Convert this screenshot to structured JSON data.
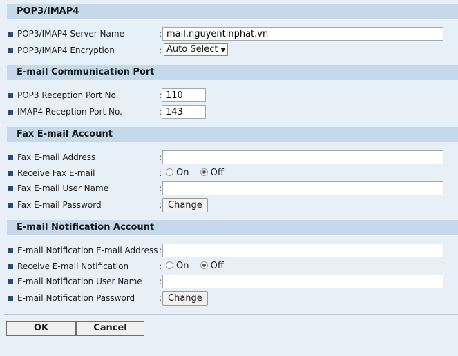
{
  "sections": {
    "pop3": {
      "title": "POP3/IMAP4",
      "server_name_label": "POP3/IMAP4 Server Name",
      "server_name_value": "mail.nguyentinphat.vn",
      "encryption_label": "POP3/IMAP4 Encryption",
      "encryption_value": "Auto Select"
    },
    "ports": {
      "title": "E-mail Communication Port",
      "pop3_port_label": "POP3 Reception Port No.",
      "pop3_port_value": "110",
      "imap4_port_label": "IMAP4 Reception Port No.",
      "imap4_port_value": "143"
    },
    "fax": {
      "title": "Fax E-mail Account",
      "address_label": "Fax E-mail Address",
      "address_value": "",
      "receive_label": "Receive Fax E-mail",
      "on_label": "On",
      "off_label": "Off",
      "receive_selected": "Off",
      "username_label": "Fax E-mail User Name",
      "username_value": "",
      "password_label": "Fax E-mail Password",
      "change_label": "Change"
    },
    "notify": {
      "title": "E-mail Notification Account",
      "address_label": "E-mail Notification E-mail Address",
      "address_value": "",
      "receive_label": "Receive E-mail Notification",
      "on_label": "On",
      "off_label": "Off",
      "receive_selected": "Off",
      "username_label": "E-mail Notification User Name",
      "username_value": "",
      "password_label": "E-mail Notification Password",
      "change_label": "Change"
    }
  },
  "colon": ":",
  "actions": {
    "ok_label": "OK",
    "cancel_label": "Cancel"
  },
  "colors": {
    "header_bg": "#c6d9ea",
    "page_bg": "#e8f0f7",
    "bullet": "#2b4a82"
  },
  "icons": {
    "bullet": "square-bullet-icon",
    "dropdown": "dropdown-arrow-icon",
    "radio": "radio-button-icon"
  }
}
